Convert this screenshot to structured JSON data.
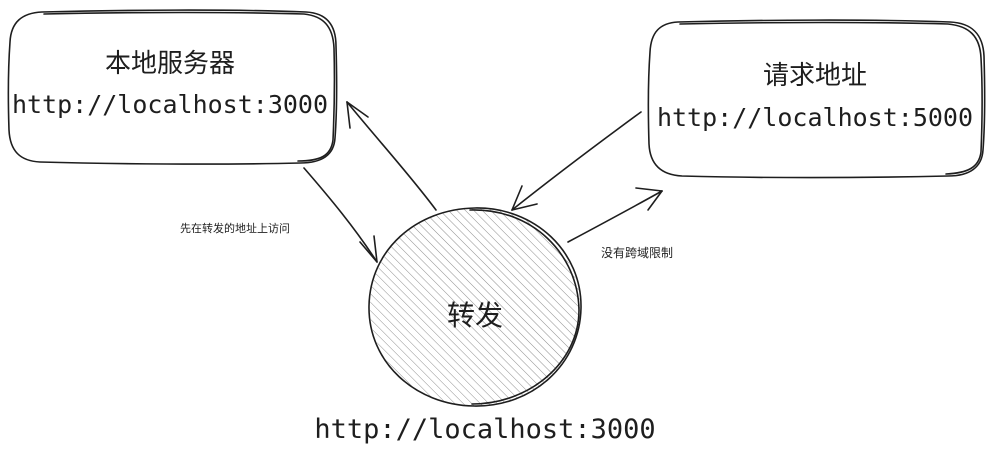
{
  "diagram": {
    "nodes": {
      "local_server": {
        "title": "本地服务器",
        "url": "http://localhost:3000"
      },
      "request_target": {
        "title": "请求地址",
        "url": "http://localhost:5000"
      },
      "proxy": {
        "title": "转发",
        "url": "http://localhost:3000"
      }
    },
    "edge_labels": {
      "server_to_proxy": "先在转发的地址上访问",
      "proxy_to_target": "没有跨域限制"
    }
  }
}
